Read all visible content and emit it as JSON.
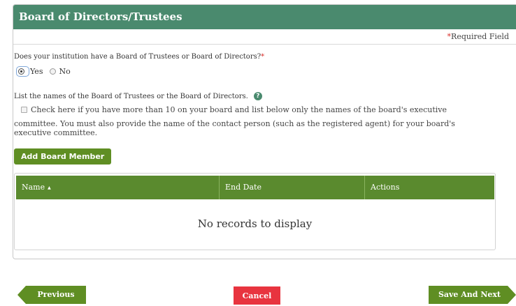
{
  "section": {
    "title": "Board of Directors/Trustees",
    "required_star": "*",
    "required_label": "Required Field"
  },
  "question": {
    "text": "Does your institution have a Board of Trustees or Board of Directors?",
    "star": "*",
    "options": [
      {
        "label": "Yes",
        "selected": true
      },
      {
        "label": "No",
        "selected": false
      }
    ]
  },
  "list_prompt": {
    "text": "List the names of the Board of Trustees or the Board of Directors.",
    "help_icon": "question-circle-icon"
  },
  "checkbox": {
    "checked": false,
    "line1": "Check here if you have more than 10 on your board and list below only the names of the board's executive",
    "line2": "committee. You must also provide the name of the contact person (such as the registered agent) for your board's",
    "line3": "executive committee."
  },
  "add_button": "Add Board Member",
  "grid": {
    "columns": [
      "Name",
      "End Date",
      "Actions"
    ],
    "sort_icon": "sort-asc-icon",
    "empty_text": "No records to display"
  },
  "footer": {
    "previous": "Previous",
    "cancel": "Cancel",
    "save_next": "Save And Next"
  },
  "colors": {
    "header_bg": "#4a8a6e",
    "button_green": "#5f8e23",
    "cancel_red": "#e8343f",
    "required_red": "#d9312b"
  }
}
